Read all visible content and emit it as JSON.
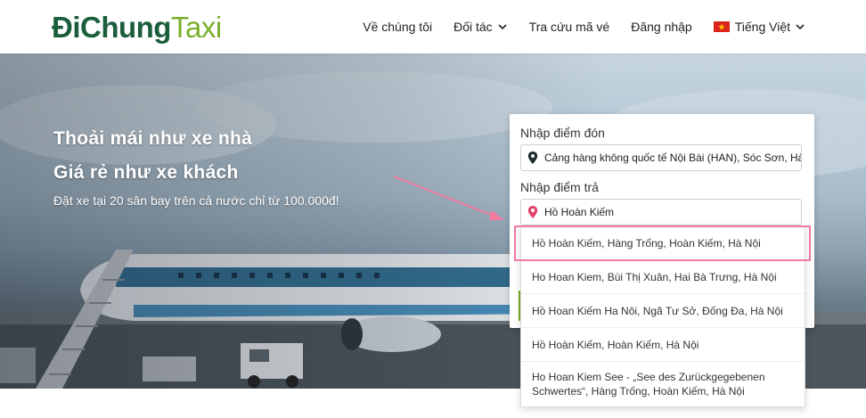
{
  "brand": {
    "logo_dark": "Đi",
    "logo_mid": "Chung",
    "logo_green": "Taxi",
    "colors": {
      "dark": "#1b5e3b",
      "green": "#7aae2b"
    }
  },
  "nav": {
    "items": [
      {
        "label": "Về chúng tôi"
      },
      {
        "label": "Đối tác"
      },
      {
        "label": "Tra cứu mã vé"
      },
      {
        "label": "Đăng nhập"
      },
      {
        "label": "Tiếng Việt"
      }
    ],
    "icons": {
      "dropdown": "chevron-down-icon",
      "flag": "vietnam-flag-icon"
    }
  },
  "hero": {
    "line1": "Thoải mái như xe nhà",
    "line2": "Giá rẻ như xe khách",
    "subtitle": "Đặt xe tại 20 sân bay trên cả nước chỉ từ 100.000đ!"
  },
  "booking": {
    "pickup_label": "Nhập điểm đón",
    "pickup_value": "Cảng hàng không quốc tế Nội Bài (HAN), Sóc Sơn, Hà Nội",
    "dropoff_label": "Nhập điểm trả",
    "dropoff_value": "Hồ Hoàn Kiếm",
    "icons": {
      "pickup": "map-pin-icon",
      "dropoff": "map-pin-icon"
    }
  },
  "suggestions": [
    {
      "text": "Hồ Hoàn Kiếm, Hàng Trống, Hoàn Kiếm, Hà Nội"
    },
    {
      "text": "Ho Hoan Kiem, Bùi Thị Xuân, Hai Bà Trưng, Hà Nội"
    },
    {
      "text": "Hồ Hoan Kiếm Ha Nôi, Ngã Tư Sở, Đống Đa, Hà Nội"
    },
    {
      "text": "Hồ Hoàn Kiếm, Hoàn Kiếm, Hà Nội"
    },
    {
      "text": "Ho Hoan Kiem See - „See des Zurückgegebenen Schwertes“, Hàng Trống, Hoàn Kiếm, Hà Nội"
    }
  ],
  "annotation": {
    "color": "#f07aa0"
  }
}
